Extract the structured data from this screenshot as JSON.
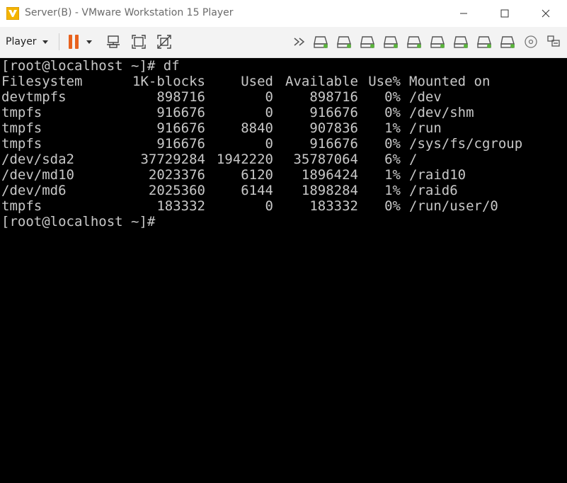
{
  "window": {
    "title": "Server(B) - VMware Workstation 15 Player",
    "app_icon": "vmware-icon",
    "controls": [
      "minimize-icon",
      "maximize-icon",
      "close-icon"
    ]
  },
  "toolbar": {
    "player_menu_label": "Player",
    "icons": [
      "pause-icon",
      "dropdown-caret-icon",
      "send-ctrl-alt-del-icon",
      "fit-guest-icon",
      "unity-icon",
      "more-devices-icon",
      "network-adapter-icon",
      "hard-disk-icon",
      "usb-device-icon",
      "cd-dvd-icon",
      "message-log-icon"
    ],
    "accent_color": "#e8621e",
    "device_indicator_color": "#5ab43c"
  },
  "terminal": {
    "prompt_line": "[root@localhost ~]# df",
    "header": {
      "filesystem": "Filesystem",
      "blocks": "1K-blocks",
      "used": "Used",
      "available": "Available",
      "use_pct": "Use%",
      "mounted": "Mounted on"
    },
    "rows": [
      {
        "filesystem": "devtmpfs",
        "blocks": "898716",
        "used": "0",
        "available": "898716",
        "use_pct": "0%",
        "mounted": "/dev"
      },
      {
        "filesystem": "tmpfs",
        "blocks": "916676",
        "used": "0",
        "available": "916676",
        "use_pct": "0%",
        "mounted": "/dev/shm"
      },
      {
        "filesystem": "tmpfs",
        "blocks": "916676",
        "used": "8840",
        "available": "907836",
        "use_pct": "1%",
        "mounted": "/run"
      },
      {
        "filesystem": "tmpfs",
        "blocks": "916676",
        "used": "0",
        "available": "916676",
        "use_pct": "0%",
        "mounted": "/sys/fs/cgroup"
      },
      {
        "filesystem": "/dev/sda2",
        "blocks": "37729284",
        "used": "1942220",
        "available": "35787064",
        "use_pct": "6%",
        "mounted": "/"
      },
      {
        "filesystem": "/dev/md10",
        "blocks": "2023376",
        "used": "6120",
        "available": "1896424",
        "use_pct": "1%",
        "mounted": "/raid10"
      },
      {
        "filesystem": "/dev/md6",
        "blocks": "2025360",
        "used": "6144",
        "available": "1898284",
        "use_pct": "1%",
        "mounted": "/raid6"
      },
      {
        "filesystem": "tmpfs",
        "blocks": "183332",
        "used": "0",
        "available": "183332",
        "use_pct": "0%",
        "mounted": "/run/user/0"
      }
    ],
    "final_prompt": "[root@localhost ~]# "
  }
}
